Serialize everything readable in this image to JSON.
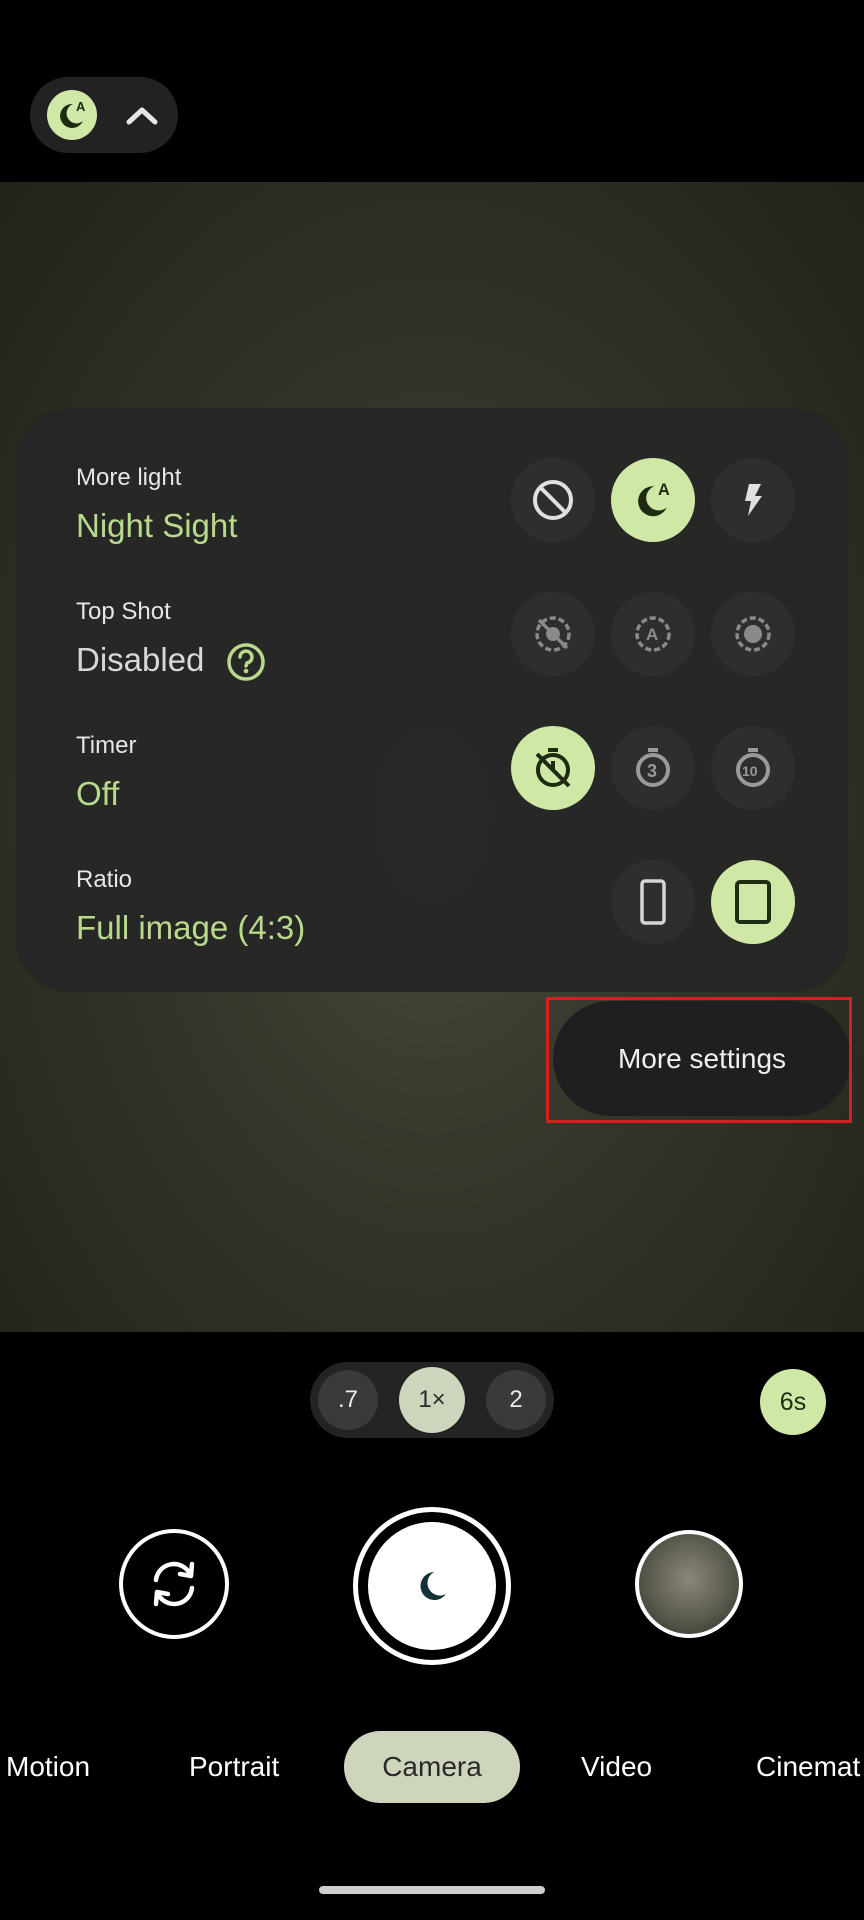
{
  "colors": {
    "accent": "#cfe8a6",
    "accent_text": "#b9d98c",
    "panel": "#262626",
    "highlight": "#d81e1e",
    "selected_mode": "#cdd6bd"
  },
  "top_bar": {
    "icons": [
      "night-sight-auto-icon",
      "chevron-up-icon"
    ]
  },
  "settings": {
    "more_light": {
      "label": "More light",
      "value": "Night Sight",
      "options": [
        "off-icon",
        "night-sight-auto-icon",
        "flash-icon"
      ],
      "selected_index": 1
    },
    "top_shot": {
      "label": "Top Shot",
      "value": "Disabled",
      "options": [
        "top-shot-off-icon",
        "top-shot-auto-icon",
        "top-shot-on-icon"
      ],
      "selected_index": -1
    },
    "timer": {
      "label": "Timer",
      "value": "Off",
      "options": [
        "timer-off-icon",
        "timer-3-icon",
        "timer-10-icon"
      ],
      "selected_index": 0
    },
    "ratio": {
      "label": "Ratio",
      "value": "Full image (4:3)",
      "options": [
        "ratio-wide-icon",
        "ratio-full-icon"
      ],
      "selected_index": 1
    }
  },
  "more_settings": {
    "label": "More settings"
  },
  "zoom": {
    "options": [
      ".7",
      "1×",
      "2"
    ],
    "selected_index": 1
  },
  "timer_badge": "6s",
  "modes": {
    "items": [
      "Motion",
      "Portrait",
      "Camera",
      "Video",
      "Cinemat"
    ],
    "selected": "Camera"
  }
}
